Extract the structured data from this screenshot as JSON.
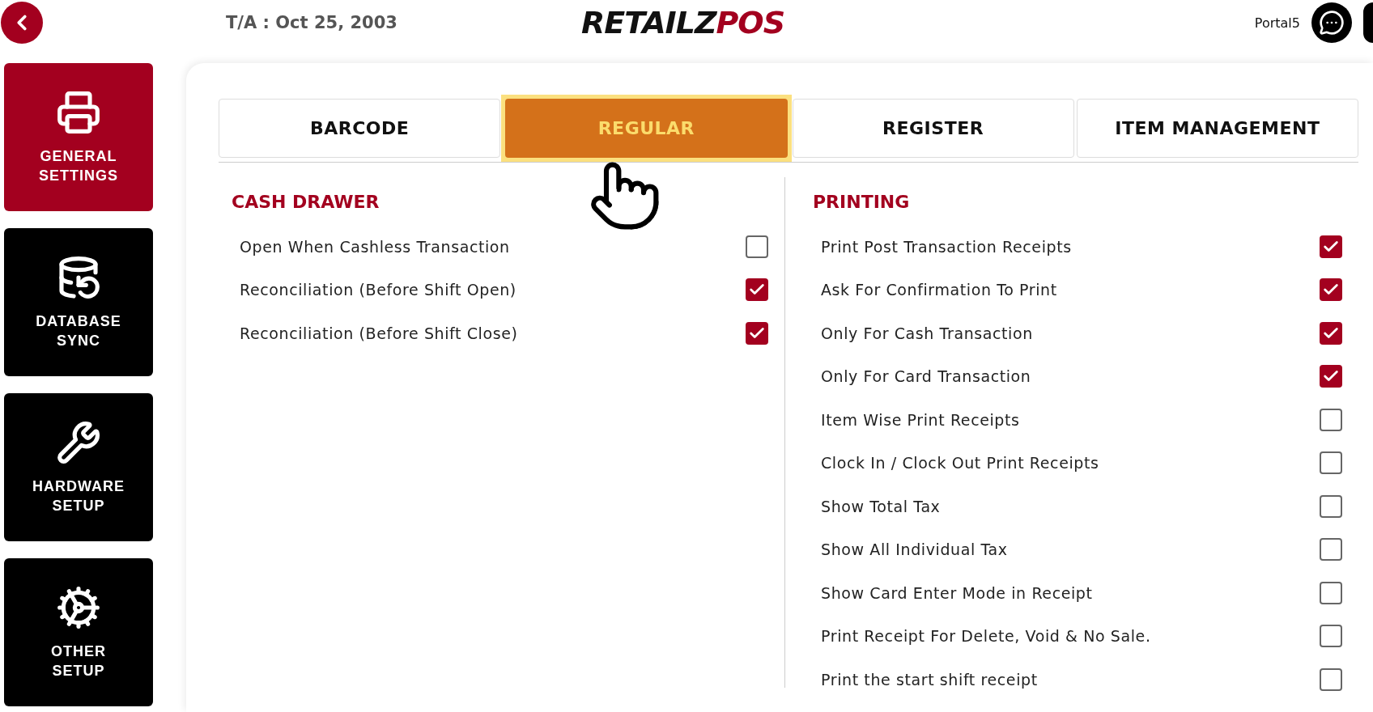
{
  "header": {
    "date": "T/A : Oct 25, 2003",
    "logo": {
      "part_1": "RETAILZ",
      "part_2": "POS"
    },
    "user": "Portal5"
  },
  "sidebar": {
    "items": [
      {
        "label": "GENERAL SETTINGS",
        "selected": true
      },
      {
        "label": "DATABASE SYNC",
        "selected": false
      },
      {
        "label": "HARDWARE SETUP",
        "selected": false
      },
      {
        "label": "OTHER SETUP",
        "selected": false
      }
    ]
  },
  "tabs": [
    {
      "label": "BARCODE",
      "selected": false
    },
    {
      "label": "REGULAR",
      "selected": true
    },
    {
      "label": "REGISTER",
      "selected": false
    },
    {
      "label": "ITEM MANAGEMENT",
      "selected": false
    }
  ],
  "sections": [
    {
      "title": "CASH DRAWER",
      "options": [
        {
          "label": "Open When Cashless Transaction",
          "checked": false
        },
        {
          "label": "Reconciliation (Before Shift Open)",
          "checked": true
        },
        {
          "label": "Reconciliation (Before Shift Close)",
          "checked": true
        }
      ]
    },
    {
      "title": "PRINTING",
      "options": [
        {
          "label": "Print Post Transaction Receipts",
          "checked": true
        },
        {
          "label": "Ask For Confirmation To Print",
          "checked": true
        },
        {
          "label": "Only For Cash Transaction",
          "checked": true
        },
        {
          "label": "Only For Card Transaction",
          "checked": true
        },
        {
          "label": "Item Wise Print Receipts",
          "checked": false
        },
        {
          "label": "Clock In / Clock Out Print Receipts",
          "checked": false
        },
        {
          "label": "Show Total Tax",
          "checked": false
        },
        {
          "label": "Show All Individual Tax",
          "checked": false
        },
        {
          "label": "Show Card Enter Mode in Receipt",
          "checked": false
        },
        {
          "label": "Print Receipt For Delete, Void & No Sale.",
          "checked": false
        },
        {
          "label": "Print the start shift receipt",
          "checked": false
        }
      ]
    }
  ]
}
